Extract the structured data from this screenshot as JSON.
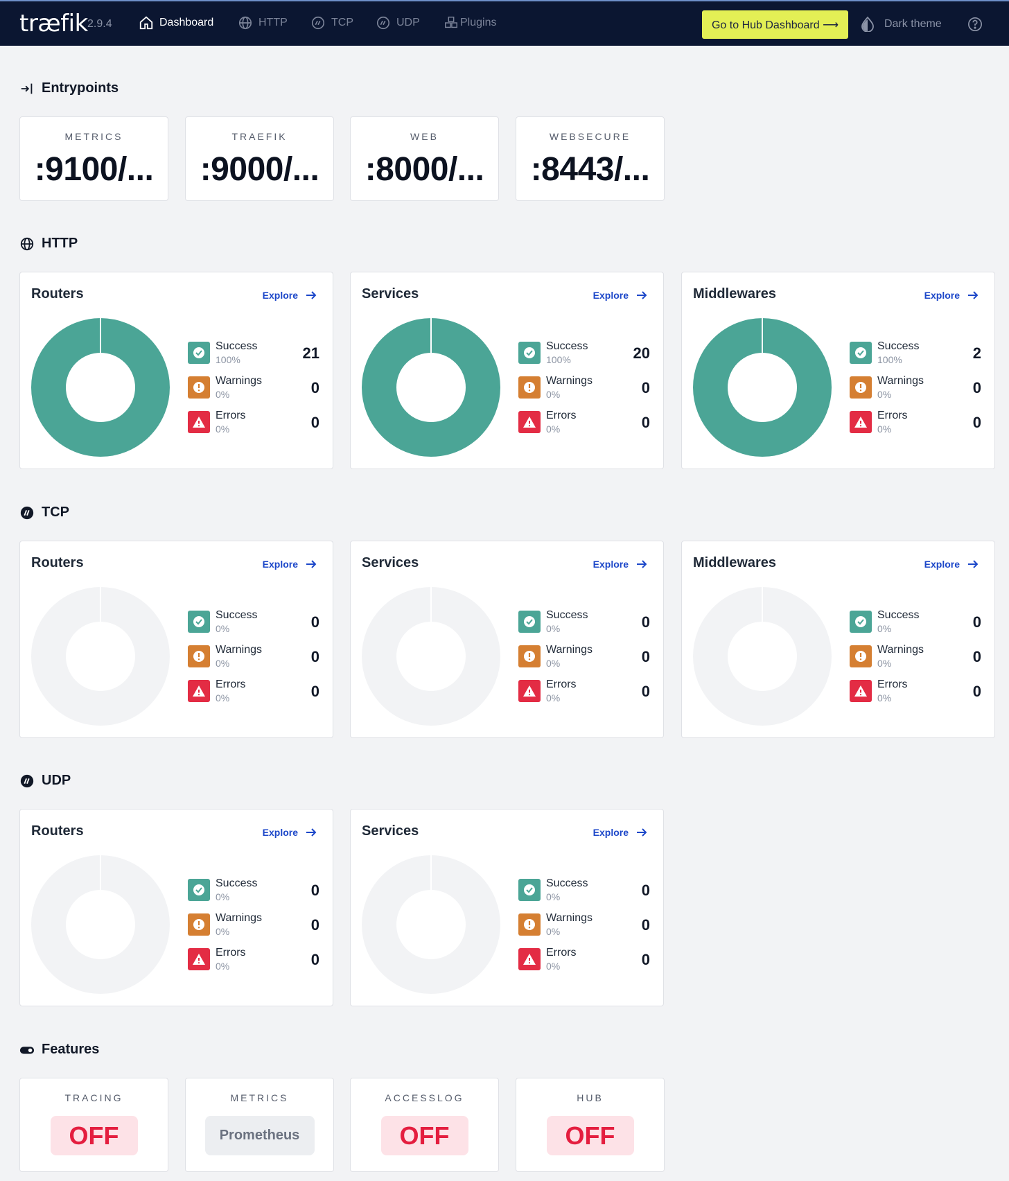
{
  "header": {
    "logo": "træfik",
    "version": "2.9.4",
    "nav": [
      {
        "label": "Dashboard",
        "icon": "home-icon",
        "active": true
      },
      {
        "label": "HTTP",
        "icon": "globe-icon",
        "active": false
      },
      {
        "label": "TCP",
        "icon": "tcp-icon",
        "active": false
      },
      {
        "label": "UDP",
        "icon": "udp-icon",
        "active": false
      },
      {
        "label": "Plugins",
        "icon": "plugins-icon",
        "active": false
      }
    ],
    "hub_button": "Go to Hub Dashboard ⟶",
    "theme_label": "Dark theme"
  },
  "entrypoints": {
    "title": "Entrypoints",
    "items": [
      {
        "name": "METRICS",
        "value": ":9100/..."
      },
      {
        "name": "TRAEFIK",
        "value": ":9000/..."
      },
      {
        "name": "WEB",
        "value": ":8000/..."
      },
      {
        "name": "WEBSECURE",
        "value": ":8443/..."
      }
    ]
  },
  "explore_label": "Explore",
  "colors": {
    "success": "#4ba596",
    "warning": "#d57f32",
    "error": "#e32c44",
    "empty": "#f2f3f5",
    "accent": "#1c47c9",
    "hub": "#e3ef55"
  },
  "sections": [
    {
      "title": "HTTP",
      "cards": [
        {
          "title": "Routers",
          "success": {
            "label": "Success",
            "pct": "100%",
            "count": "21"
          },
          "warnings": {
            "label": "Warnings",
            "pct": "0%",
            "count": "0"
          },
          "errors": {
            "label": "Errors",
            "pct": "0%",
            "count": "0"
          }
        },
        {
          "title": "Services",
          "success": {
            "label": "Success",
            "pct": "100%",
            "count": "20"
          },
          "warnings": {
            "label": "Warnings",
            "pct": "0%",
            "count": "0"
          },
          "errors": {
            "label": "Errors",
            "pct": "0%",
            "count": "0"
          }
        },
        {
          "title": "Middlewares",
          "success": {
            "label": "Success",
            "pct": "100%",
            "count": "2"
          },
          "warnings": {
            "label": "Warnings",
            "pct": "0%",
            "count": "0"
          },
          "errors": {
            "label": "Errors",
            "pct": "0%",
            "count": "0"
          }
        }
      ]
    },
    {
      "title": "TCP",
      "cards": [
        {
          "title": "Routers",
          "success": {
            "label": "Success",
            "pct": "0%",
            "count": "0"
          },
          "warnings": {
            "label": "Warnings",
            "pct": "0%",
            "count": "0"
          },
          "errors": {
            "label": "Errors",
            "pct": "0%",
            "count": "0"
          }
        },
        {
          "title": "Services",
          "success": {
            "label": "Success",
            "pct": "0%",
            "count": "0"
          },
          "warnings": {
            "label": "Warnings",
            "pct": "0%",
            "count": "0"
          },
          "errors": {
            "label": "Errors",
            "pct": "0%",
            "count": "0"
          }
        },
        {
          "title": "Middlewares",
          "success": {
            "label": "Success",
            "pct": "0%",
            "count": "0"
          },
          "warnings": {
            "label": "Warnings",
            "pct": "0%",
            "count": "0"
          },
          "errors": {
            "label": "Errors",
            "pct": "0%",
            "count": "0"
          }
        }
      ]
    },
    {
      "title": "UDP",
      "cards": [
        {
          "title": "Routers",
          "success": {
            "label": "Success",
            "pct": "0%",
            "count": "0"
          },
          "warnings": {
            "label": "Warnings",
            "pct": "0%",
            "count": "0"
          },
          "errors": {
            "label": "Errors",
            "pct": "0%",
            "count": "0"
          }
        },
        {
          "title": "Services",
          "success": {
            "label": "Success",
            "pct": "0%",
            "count": "0"
          },
          "warnings": {
            "label": "Warnings",
            "pct": "0%",
            "count": "0"
          },
          "errors": {
            "label": "Errors",
            "pct": "0%",
            "count": "0"
          }
        }
      ]
    }
  ],
  "features": {
    "title": "Features",
    "items": [
      {
        "name": "TRACING",
        "value": "OFF",
        "enabled": false
      },
      {
        "name": "METRICS",
        "value": "Prometheus",
        "enabled": true
      },
      {
        "name": "ACCESSLOG",
        "value": "OFF",
        "enabled": false
      },
      {
        "name": "HUB",
        "value": "OFF",
        "enabled": false
      }
    ]
  }
}
